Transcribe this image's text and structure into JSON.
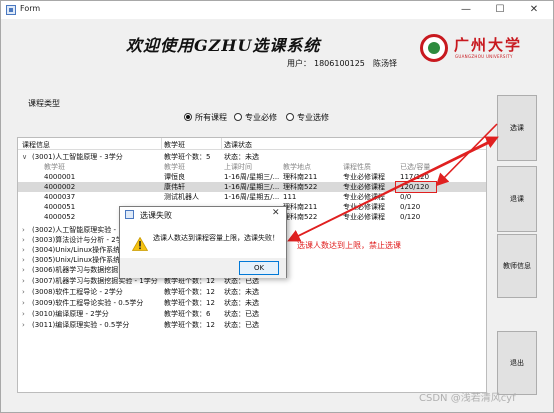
{
  "window": {
    "title": "Form",
    "min_symbol": "—",
    "max_symbol": "☐",
    "close_symbol": "✕"
  },
  "banner": {
    "title": "欢迎使用GZHU选课系统",
    "user_label": "用户：",
    "user_id": "1806100125",
    "user_name": "陈汤铎"
  },
  "logo": {
    "text": "广州大学",
    "subtext": "GUANGZHOU UNIVERSITY",
    "colors": {
      "ring": "#c8191f",
      "center": "#2d8a3e"
    }
  },
  "course_type": {
    "label": "课程类型",
    "options": [
      "所有课程",
      "专业必修",
      "专业选修"
    ],
    "selected": "所有课程"
  },
  "tree": {
    "headers": [
      "课程信息",
      "教学班",
      "选课状态"
    ],
    "subheaders": [
      "教学班",
      "上课时间",
      "教学地点",
      "课程性质",
      "已选/容量"
    ],
    "courses": [
      {
        "name": "(3001)人工智能原理 - 3学分",
        "class_count": "教学班个数：5",
        "status": "状态：未选",
        "expanded": true,
        "classes": [
          {
            "id": "4000001",
            "teacher": "谭恒良",
            "time": "1-16周/星期三/...",
            "place": "理科南211",
            "type": "专业必修课程",
            "cap": "117/120"
          },
          {
            "id": "4000002",
            "teacher": "康伟轩",
            "time": "1-16周/星期三/...",
            "place": "理科南522",
            "type": "专业必修课程",
            "cap": "120/120"
          },
          {
            "id": "4000037",
            "teacher": "测试机器人",
            "time": "1-16周/星期五/...",
            "place": "111",
            "type": "专业必修课程",
            "cap": "0/0"
          },
          {
            "id": "4000051",
            "teacher": "",
            "time": "",
            "place": "理科南211",
            "type": "专业必修课程",
            "cap": "0/120"
          },
          {
            "id": "4000052",
            "teacher": "",
            "time": "",
            "place": "理科南522",
            "type": "专业必修课程",
            "cap": "0/120"
          }
        ]
      },
      {
        "name": "(3002)人工智能原理实验 -",
        "class_count": "",
        "status": ""
      },
      {
        "name": "(3003)算法设计与分析 - 2学",
        "class_count": "",
        "status": ""
      },
      {
        "name": "(3004)Unix/Linux操作系统",
        "class_count": "",
        "status": ""
      },
      {
        "name": "(3005)Unix/Linux操作系统",
        "class_count": "",
        "status": ""
      },
      {
        "name": "(3006)机器学习与数据挖掘",
        "class_count": "",
        "status": ""
      },
      {
        "name": "(3007)机器学习与数据挖掘实验 - 1学分",
        "class_count": "教学班个数：12",
        "status": "状态：已选"
      },
      {
        "name": "(3008)软件工程导论 - 2学分",
        "class_count": "教学班个数：12",
        "status": "状态：未选"
      },
      {
        "name": "(3009)软件工程导论实验 - 0.5学分",
        "class_count": "教学班个数：12",
        "status": "状态：未选"
      },
      {
        "name": "(3010)编译原理 - 2学分",
        "class_count": "教学班个数：6",
        "status": "状态：已选"
      },
      {
        "name": "(3011)编译原理实验 - 0.5学分",
        "class_count": "教学班个数：12",
        "status": "状态：已选"
      }
    ]
  },
  "buttons": {
    "select": "选课",
    "drop": "退课",
    "info": "教师信息",
    "exit": "退出"
  },
  "dialog": {
    "title": "选课失败",
    "message": "选课人数达到课程容量上限，选课失败！",
    "ok": "OK",
    "close_symbol": "✕"
  },
  "annotation": {
    "text": "选课人数达到上限，禁止选课",
    "color": "#e02020"
  },
  "watermark": "CSDN @浅若清风cyf"
}
